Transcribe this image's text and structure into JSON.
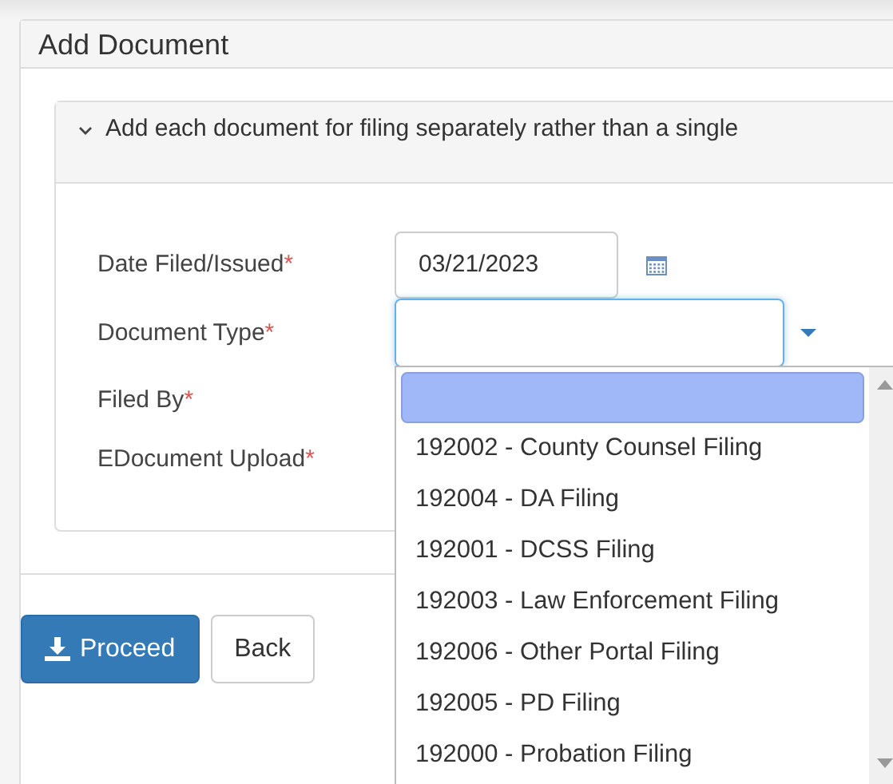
{
  "panel": {
    "title": "Add Document"
  },
  "notice": {
    "text": "Add each document for filing separately rather than a single",
    "expanded": true
  },
  "fields": [
    {
      "label": "Date Filed/Issued",
      "required_mark": "*",
      "kind": "date",
      "value": "03/21/2023"
    },
    {
      "label": "Document Type",
      "required_mark": "*",
      "kind": "select",
      "focused": true
    },
    {
      "label": "Filed By",
      "required_mark": "*",
      "kind": "hidden"
    },
    {
      "label": "EDocument Upload",
      "required_mark": "*",
      "kind": "hidden"
    }
  ],
  "dropdown": {
    "options": [
      {
        "selected": true
      },
      {
        "label": "192002 - County Counsel Filing",
        "selected": false
      },
      {
        "label": "192004 - DA Filing",
        "selected": false
      },
      {
        "label": "192001 - DCSS Filing",
        "selected": false
      },
      {
        "label": "192003 - Law Enforcement Filing",
        "selected": false
      },
      {
        "label": "192006 - Other Portal Filing",
        "selected": false
      },
      {
        "label": "192005 - PD Filing",
        "selected": false
      },
      {
        "label": "192000 - Probation Filing",
        "selected": false
      }
    ]
  },
  "buttons": [
    {
      "label": "Proceed",
      "kind": "primary"
    },
    {
      "label": "Back",
      "kind": "default"
    }
  ]
}
